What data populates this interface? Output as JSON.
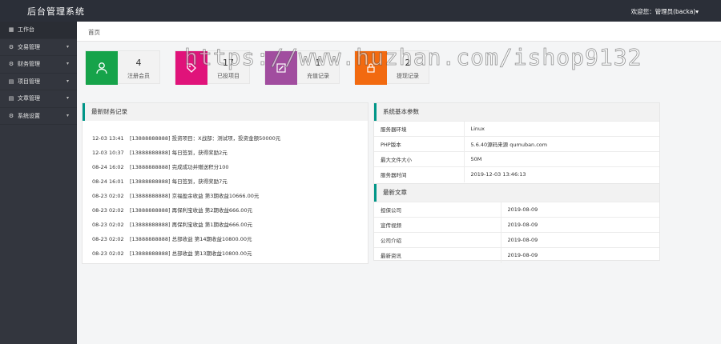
{
  "header": {
    "title": "后台管理系统",
    "user_greeting": "欢迎您：管理员(backa)",
    "user_caret": "▾"
  },
  "sidebar": {
    "items": [
      {
        "label": "工作台",
        "icon": "▦"
      },
      {
        "label": "交易管理",
        "icon": "⚙",
        "caret": "▾"
      },
      {
        "label": "财务管理",
        "icon": "⚙",
        "caret": "▾"
      },
      {
        "label": "项目管理",
        "icon": "▤",
        "caret": "▾"
      },
      {
        "label": "文章管理",
        "icon": "▤",
        "caret": "▾"
      },
      {
        "label": "系统设置",
        "icon": "⚙",
        "caret": "▾"
      }
    ]
  },
  "breadcrumb": "首页",
  "stats": [
    {
      "value": "4",
      "label": "注册会员",
      "color": "#16a34a",
      "icon": "user-icon"
    },
    {
      "value": "17",
      "label": "已投项目",
      "color": "#e0137a",
      "icon": "tag-icon"
    },
    {
      "value": "1",
      "label": "充值记录",
      "color": "#a14d9f",
      "icon": "edit-icon"
    },
    {
      "value": "2",
      "label": "提现记录",
      "color": "#f26a10",
      "icon": "lock-icon"
    }
  ],
  "finance": {
    "title": "最新财务记录",
    "rows": [
      {
        "time": "12-03 13:41",
        "text": "[13888888888] 投资项目：X战部：测试项，投资金额50000元"
      },
      {
        "time": "12-03 10:37",
        "text": "[13888888888] 每日签到，获得奖励2元"
      },
      {
        "time": "08-24 16:02",
        "text": "[13888888888] 完成成功并赠送积分100"
      },
      {
        "time": "08-24 16:01",
        "text": "[13888888888] 每日签到，获得奖励7元"
      },
      {
        "time": "08-23 02:02",
        "text": "[13888888888] 京福盈余收益 第3期收益10666.00元"
      },
      {
        "time": "08-23 02:02",
        "text": "[13888888888] 再保利宝收益 第2期收益666.00元"
      },
      {
        "time": "08-23 02:02",
        "text": "[13888888888] 再保利宝收益 第1期收益666.00元"
      },
      {
        "time": "08-23 02:02",
        "text": "[13888888888] 总部收益 第14期收益10800.00元"
      },
      {
        "time": "08-23 02:02",
        "text": "[13888888888] 总部收益 第13期收益10800.00元"
      }
    ]
  },
  "sysinfo": {
    "title": "系统基本参数",
    "rows": [
      {
        "key": "服务器环境",
        "value": "Linux"
      },
      {
        "key": "PHP版本",
        "value": "5.6.40源码来源 qumuban.com"
      },
      {
        "key": "最大文件大小",
        "value": "50M"
      },
      {
        "key": "服务器时间",
        "value": "2019-12-03 13:46:13"
      }
    ]
  },
  "articles": {
    "title": "最新文章",
    "rows": [
      {
        "title": "担保公司",
        "date": "2019-08-09"
      },
      {
        "title": "宣传视频",
        "date": "2019-08-09"
      },
      {
        "title": "公司介绍",
        "date": "2019-08-09"
      },
      {
        "title": "最新资讯",
        "date": "2019-08-09"
      }
    ]
  },
  "watermark": "https://www.huzhan.com/ishop9132"
}
